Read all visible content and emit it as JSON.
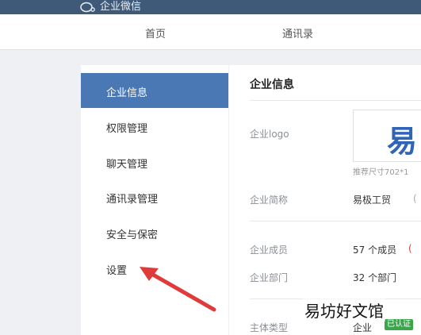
{
  "header": {
    "app_name": "企业微信"
  },
  "nav": {
    "home": "首页",
    "contacts": "通讯录"
  },
  "sidebar": {
    "items": [
      {
        "label": "企业信息",
        "active": true
      },
      {
        "label": "权限管理"
      },
      {
        "label": "聊天管理"
      },
      {
        "label": "通讯录管理"
      },
      {
        "label": "安全与保密"
      },
      {
        "label": "设置"
      }
    ]
  },
  "main": {
    "title": "企业信息",
    "logo_label": "企业logo",
    "logo_char": "易",
    "logo_hint": "推荐尺寸702*1",
    "short_name_label": "企业简称",
    "short_name_value": "易极工贸",
    "short_name_paren": "(",
    "members_label": "企业成员",
    "members_value": "57 个成员",
    "members_paren": "(",
    "departments_label": "企业部门",
    "departments_value": "32 个部门",
    "entity_type_label": "主体类型",
    "entity_type_value": "企业",
    "verified_badge": "已认证"
  },
  "watermark": "易坊好文馆",
  "colors": {
    "topbar": "#3f5a78",
    "active": "#4a78b5",
    "arrow": "#e03a3a",
    "badge": "#3aa64a"
  }
}
